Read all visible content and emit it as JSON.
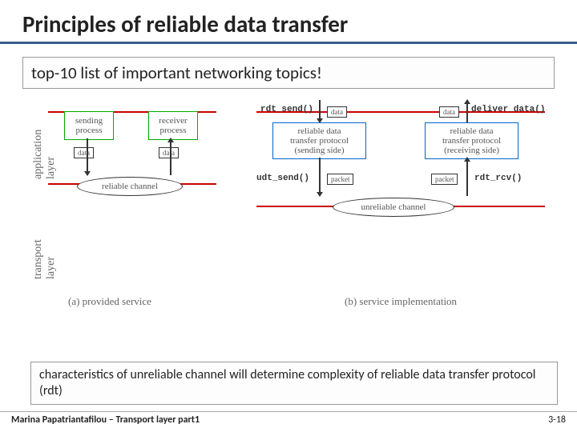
{
  "title": "Principles of reliable data transfer",
  "subtitle": "top-10 list of important networking topics!",
  "side_labels": {
    "application": "application\nlayer",
    "transport": "transport\nlayer"
  },
  "boxes": {
    "sending_process": "sending\nprocess",
    "receiver_process": "receiver\nprocess",
    "reliable_channel": "reliable channel",
    "reliable_send": "reliable data\ntransfer protocol\n(sending side)",
    "reliable_recv": "reliable data\ntransfer protocol\n(receiving side)",
    "unreliable_channel": "unreliable channel",
    "data": "data",
    "packet": "packet"
  },
  "funcs": {
    "rdt_send": "rdt_send()",
    "deliver_data": "deliver_data()",
    "udt_send": "udt_send()",
    "rdt_rcv": "rdt_rcv()"
  },
  "captions": {
    "a": "(a) provided service",
    "b": "(b) service implementation"
  },
  "bottom_text": "characteristics of unreliable channel will determine complexity of reliable data transfer protocol (rdt)",
  "footer": {
    "left": "Marina Papatriantafilou – Transport layer part1",
    "right": "3-18"
  }
}
